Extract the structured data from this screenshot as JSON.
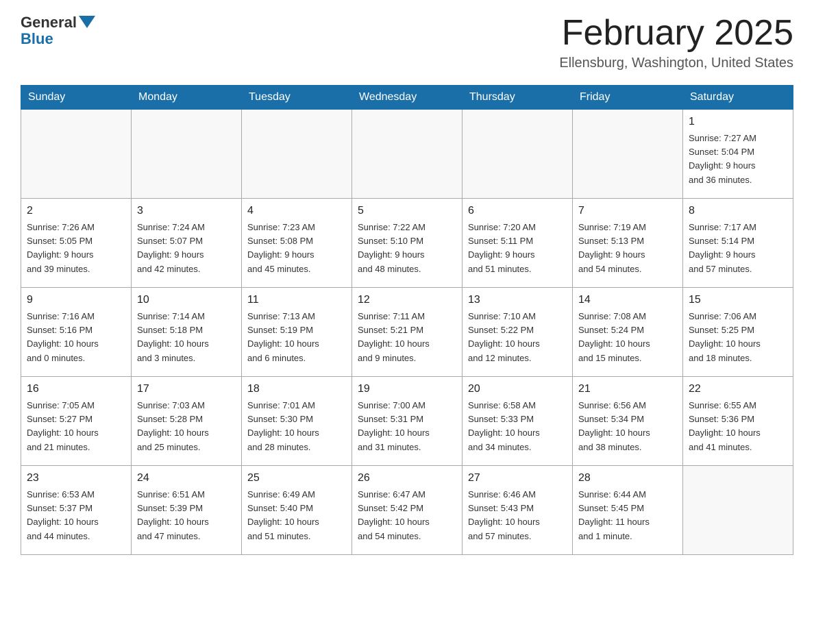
{
  "header": {
    "logo_general": "General",
    "logo_blue": "Blue",
    "title": "February 2025",
    "location": "Ellensburg, Washington, United States"
  },
  "days_of_week": [
    "Sunday",
    "Monday",
    "Tuesday",
    "Wednesday",
    "Thursday",
    "Friday",
    "Saturday"
  ],
  "weeks": [
    [
      {
        "day": "",
        "info": ""
      },
      {
        "day": "",
        "info": ""
      },
      {
        "day": "",
        "info": ""
      },
      {
        "day": "",
        "info": ""
      },
      {
        "day": "",
        "info": ""
      },
      {
        "day": "",
        "info": ""
      },
      {
        "day": "1",
        "info": "Sunrise: 7:27 AM\nSunset: 5:04 PM\nDaylight: 9 hours\nand 36 minutes."
      }
    ],
    [
      {
        "day": "2",
        "info": "Sunrise: 7:26 AM\nSunset: 5:05 PM\nDaylight: 9 hours\nand 39 minutes."
      },
      {
        "day": "3",
        "info": "Sunrise: 7:24 AM\nSunset: 5:07 PM\nDaylight: 9 hours\nand 42 minutes."
      },
      {
        "day": "4",
        "info": "Sunrise: 7:23 AM\nSunset: 5:08 PM\nDaylight: 9 hours\nand 45 minutes."
      },
      {
        "day": "5",
        "info": "Sunrise: 7:22 AM\nSunset: 5:10 PM\nDaylight: 9 hours\nand 48 minutes."
      },
      {
        "day": "6",
        "info": "Sunrise: 7:20 AM\nSunset: 5:11 PM\nDaylight: 9 hours\nand 51 minutes."
      },
      {
        "day": "7",
        "info": "Sunrise: 7:19 AM\nSunset: 5:13 PM\nDaylight: 9 hours\nand 54 minutes."
      },
      {
        "day": "8",
        "info": "Sunrise: 7:17 AM\nSunset: 5:14 PM\nDaylight: 9 hours\nand 57 minutes."
      }
    ],
    [
      {
        "day": "9",
        "info": "Sunrise: 7:16 AM\nSunset: 5:16 PM\nDaylight: 10 hours\nand 0 minutes."
      },
      {
        "day": "10",
        "info": "Sunrise: 7:14 AM\nSunset: 5:18 PM\nDaylight: 10 hours\nand 3 minutes."
      },
      {
        "day": "11",
        "info": "Sunrise: 7:13 AM\nSunset: 5:19 PM\nDaylight: 10 hours\nand 6 minutes."
      },
      {
        "day": "12",
        "info": "Sunrise: 7:11 AM\nSunset: 5:21 PM\nDaylight: 10 hours\nand 9 minutes."
      },
      {
        "day": "13",
        "info": "Sunrise: 7:10 AM\nSunset: 5:22 PM\nDaylight: 10 hours\nand 12 minutes."
      },
      {
        "day": "14",
        "info": "Sunrise: 7:08 AM\nSunset: 5:24 PM\nDaylight: 10 hours\nand 15 minutes."
      },
      {
        "day": "15",
        "info": "Sunrise: 7:06 AM\nSunset: 5:25 PM\nDaylight: 10 hours\nand 18 minutes."
      }
    ],
    [
      {
        "day": "16",
        "info": "Sunrise: 7:05 AM\nSunset: 5:27 PM\nDaylight: 10 hours\nand 21 minutes."
      },
      {
        "day": "17",
        "info": "Sunrise: 7:03 AM\nSunset: 5:28 PM\nDaylight: 10 hours\nand 25 minutes."
      },
      {
        "day": "18",
        "info": "Sunrise: 7:01 AM\nSunset: 5:30 PM\nDaylight: 10 hours\nand 28 minutes."
      },
      {
        "day": "19",
        "info": "Sunrise: 7:00 AM\nSunset: 5:31 PM\nDaylight: 10 hours\nand 31 minutes."
      },
      {
        "day": "20",
        "info": "Sunrise: 6:58 AM\nSunset: 5:33 PM\nDaylight: 10 hours\nand 34 minutes."
      },
      {
        "day": "21",
        "info": "Sunrise: 6:56 AM\nSunset: 5:34 PM\nDaylight: 10 hours\nand 38 minutes."
      },
      {
        "day": "22",
        "info": "Sunrise: 6:55 AM\nSunset: 5:36 PM\nDaylight: 10 hours\nand 41 minutes."
      }
    ],
    [
      {
        "day": "23",
        "info": "Sunrise: 6:53 AM\nSunset: 5:37 PM\nDaylight: 10 hours\nand 44 minutes."
      },
      {
        "day": "24",
        "info": "Sunrise: 6:51 AM\nSunset: 5:39 PM\nDaylight: 10 hours\nand 47 minutes."
      },
      {
        "day": "25",
        "info": "Sunrise: 6:49 AM\nSunset: 5:40 PM\nDaylight: 10 hours\nand 51 minutes."
      },
      {
        "day": "26",
        "info": "Sunrise: 6:47 AM\nSunset: 5:42 PM\nDaylight: 10 hours\nand 54 minutes."
      },
      {
        "day": "27",
        "info": "Sunrise: 6:46 AM\nSunset: 5:43 PM\nDaylight: 10 hours\nand 57 minutes."
      },
      {
        "day": "28",
        "info": "Sunrise: 6:44 AM\nSunset: 5:45 PM\nDaylight: 11 hours\nand 1 minute."
      },
      {
        "day": "",
        "info": ""
      }
    ]
  ]
}
